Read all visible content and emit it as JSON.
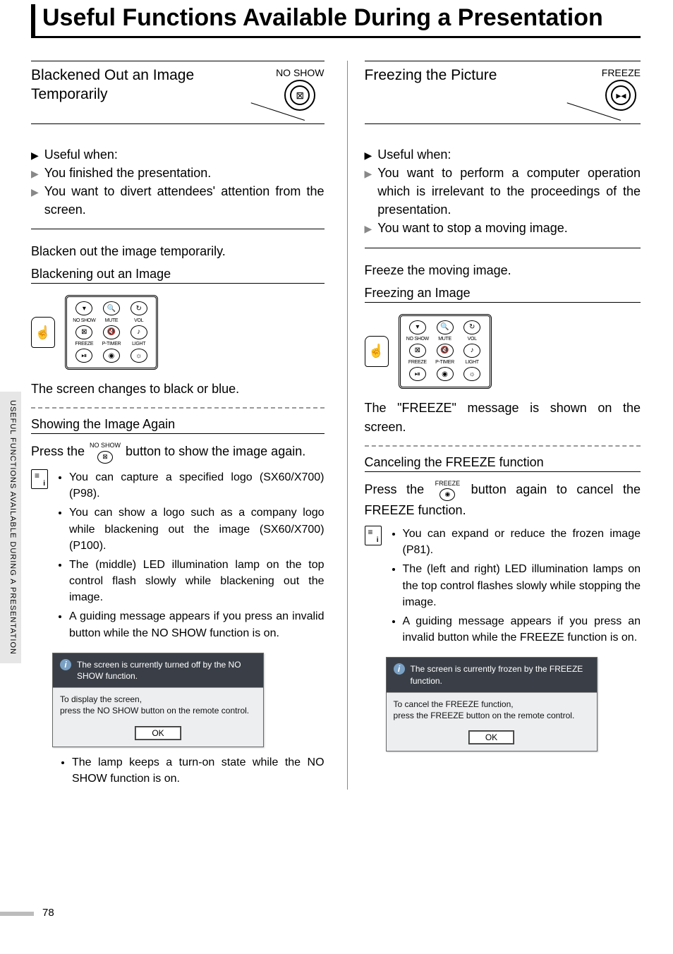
{
  "side_tab": "USEFUL FUNCTIONS AVAILABLE DURING A PRESENTATION",
  "page_number": "78",
  "title": "Useful Functions Available During a Presentation",
  "left": {
    "heading": "Blackened Out an Image Temporarily",
    "button_label": "NO SHOW",
    "button_glyph": "⊠",
    "useful_head": "Useful when:",
    "useful1": "You finished the presentation.",
    "useful2": "You want to divert attendees' attention from the screen.",
    "instruction": "Blacken out the image temporarily.",
    "sub1": "Blackening out an Image",
    "result": "The screen changes to black or blue.",
    "sub2": "Showing the Image Again",
    "press_a": "Press the ",
    "press_b": " button to show the image again.",
    "inline_btn_lbl": "NO SHOW",
    "inline_btn_glyph": "⊠",
    "notes": [
      "You can capture a specified logo (SX60/X700) (P98).",
      "You can show a logo such as a company logo while blackening out the image (SX60/X700) (P100).",
      "The (middle) LED illumination lamp on the top control flash slowly while blackening out the image.",
      "A guiding message appears if you press an invalid button while the NO SHOW function is on."
    ],
    "dialog_top": "The screen is currently turned off by the NO SHOW function.",
    "dialog_mid": "To display the screen,\npress the NO SHOW button on the remote control.",
    "dialog_ok": "OK",
    "note_after": "The lamp keeps a turn-on state while the NO SHOW function is on."
  },
  "right": {
    "heading": "Freezing the Picture",
    "button_label": "FREEZE",
    "button_glyph": "▸◂",
    "useful_head": "Useful when:",
    "useful1": "You want to perform a computer operation which is irrelevant to the proceedings of the presentation.",
    "useful2": "You want to stop a moving image.",
    "instruction": "Freeze the moving image.",
    "sub1": "Freezing an Image",
    "result": "The \"FREEZE\" message is shown on the screen.",
    "sub2": "Canceling the FREEZE function",
    "press_a": "Press the ",
    "press_b": " button again to cancel the FREEZE function.",
    "inline_btn_lbl": "FREEZE",
    "inline_btn_glyph": "◉",
    "notes": [
      "You can expand or reduce the frozen image (P81).",
      "The (left and right) LED illumination lamps on the top control flashes slowly while stopping the image.",
      "A guiding message appears if you press an invalid button while the FREEZE function is on."
    ],
    "dialog_top": "The screen is currently frozen by the FREEZE function.",
    "dialog_mid": "To cancel the FREEZE function,\npress the FREEZE button on the remote control.",
    "dialog_ok": "OK"
  },
  "remote": {
    "labels": [
      "NO SHOW",
      "MUTE",
      "VOL",
      "FREEZE",
      "P-TIMER",
      "LIGHT"
    ],
    "top_glyphs": [
      "▾",
      "🔍",
      "↻"
    ],
    "mid_glyphs": [
      "⊠",
      "🔇",
      "♪"
    ],
    "bot_glyphs": [
      "⏯",
      "◉",
      "☼"
    ]
  }
}
